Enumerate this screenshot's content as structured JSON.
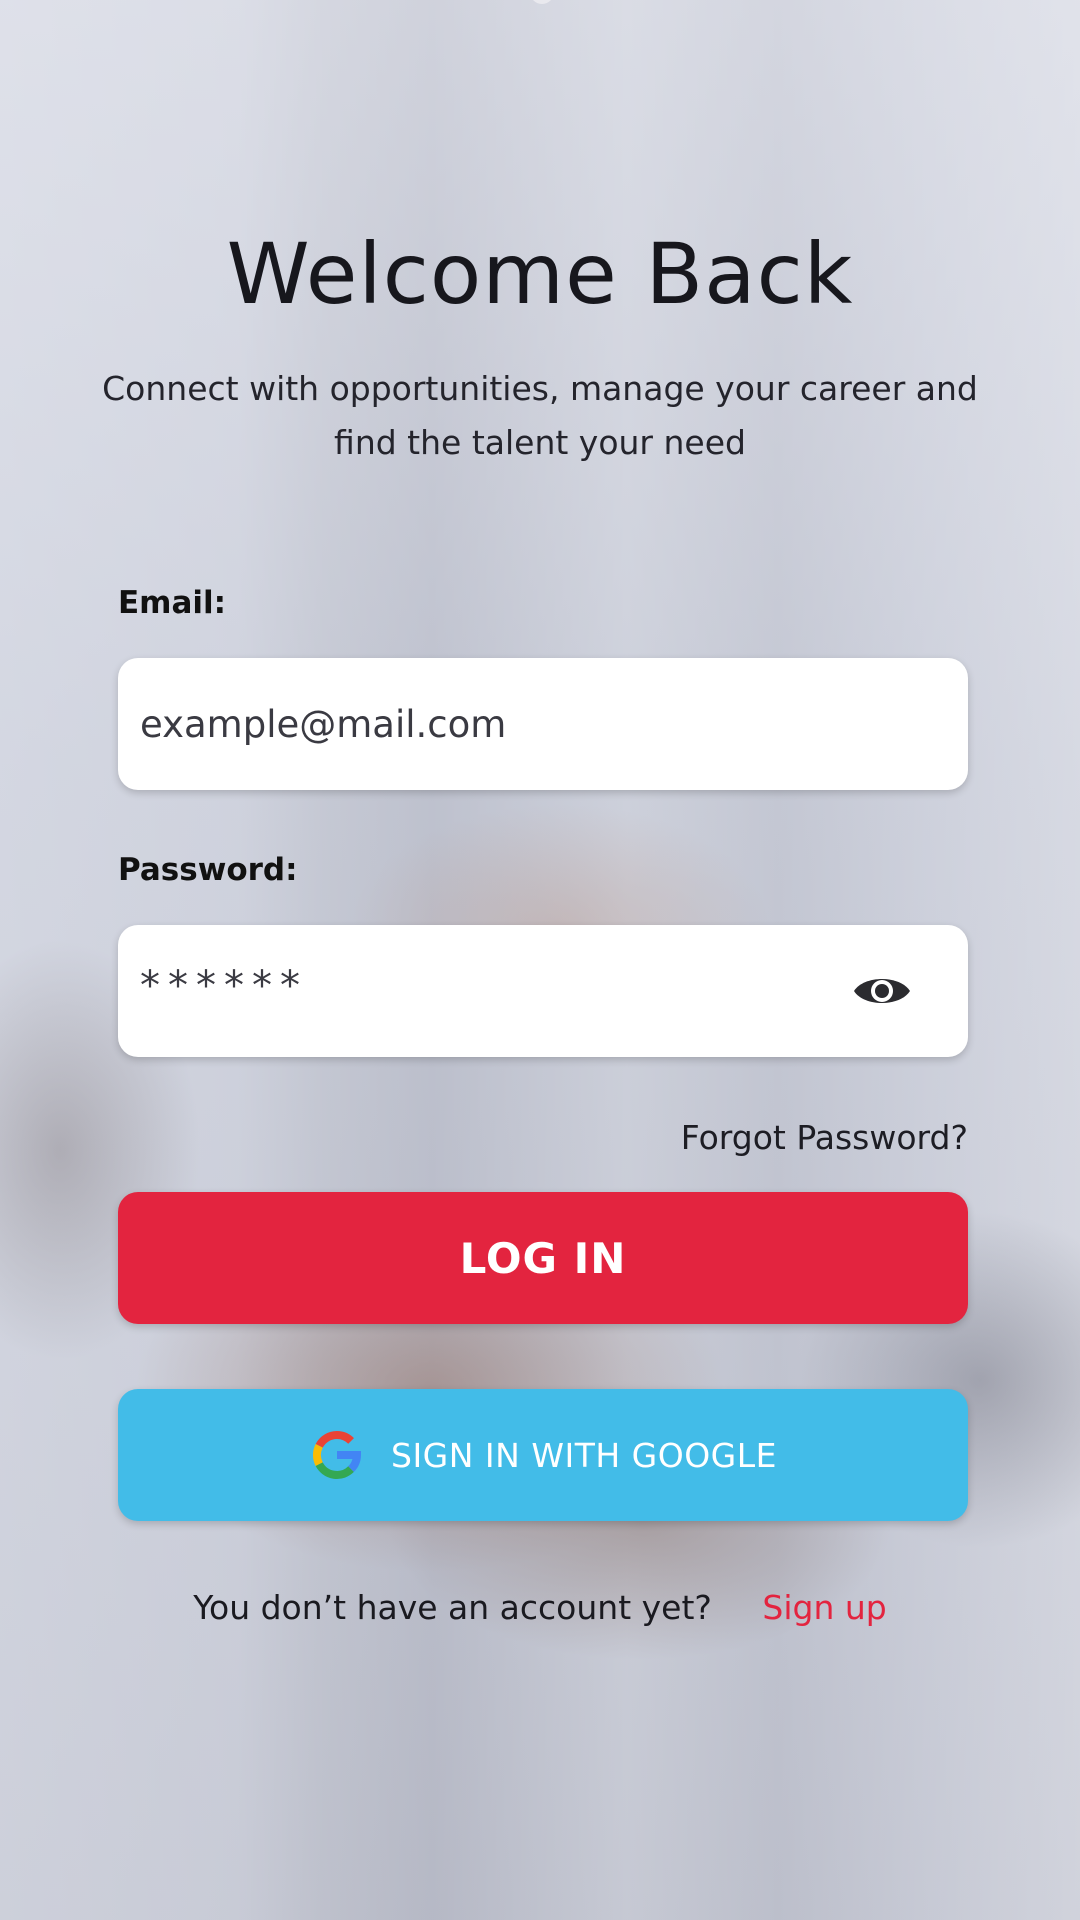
{
  "header": {
    "title": "Welcome Back",
    "subtitle_line1": "Connect with opportunities, manage your career and",
    "subtitle_line2": "find the talent your need"
  },
  "form": {
    "email_label": "Email:",
    "email_value": "example@mail.com",
    "password_label": "Password:",
    "password_value": "******",
    "password_toggle_icon": "eye-icon",
    "forgot_password": "Forgot Password?"
  },
  "actions": {
    "login_label": "LOG IN",
    "login_color": "#e3243f",
    "google_label": "SIGN IN WITH GOOGLE",
    "google_color": "#42bce8",
    "google_icon": "google-icon"
  },
  "footer": {
    "question": "You don’t have an account yet?",
    "signup_link": "Sign up"
  }
}
